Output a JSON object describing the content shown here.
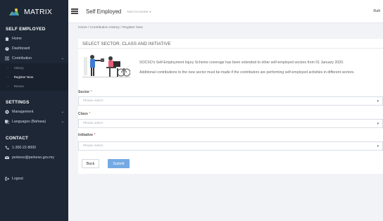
{
  "brand": {
    "name": "MATRIX"
  },
  "sidebar": {
    "section_self": "SELF EMPLOYED",
    "items": [
      {
        "label": "Home",
        "icon": "home-icon"
      },
      {
        "label": "Dashboard",
        "icon": "dashboard-icon"
      },
      {
        "label": "Contribution",
        "icon": "money-icon"
      }
    ],
    "sub_items": [
      {
        "label": "History"
      },
      {
        "label": "Register New"
      },
      {
        "label": "Renew"
      }
    ],
    "section_settings": "SETTINGS",
    "settings_items": [
      {
        "label": "Management",
        "icon": "gear-icon"
      },
      {
        "label": "Languages (Bahasa)",
        "icon": "language-icon"
      }
    ],
    "section_contact": "CONTACT",
    "contact_items": [
      {
        "label": "1-300-22-8000",
        "icon": "phone-icon"
      },
      {
        "label": "perkeso@perkeso.gov.my",
        "icon": "mail-icon"
      }
    ],
    "logout": "Logout"
  },
  "topbar": {
    "title": "Self Employed",
    "switch_mode": "SWITCH MODE ▾",
    "user": "Rafi"
  },
  "breadcrumb": "Home  /  Contribution History  /  Register New",
  "card": {
    "title": "SELECT SECTOR, CLASS AND INITIATIVE",
    "info_1": "SOCSO's Self-Employment Injury Scheme coverage has been extended to other self-employed sectors from 01 January 2020.",
    "info_2": "Additional contributions to the new sector must be made if the contributors are performing self-employed activities in different sectors."
  },
  "form": {
    "sector_label": "Sector",
    "class_label": "Class",
    "initiative_label": "Initiative",
    "required_mark": "*",
    "placeholder": "Please select",
    "arrow": "▼"
  },
  "buttons": {
    "back": "Back",
    "submit": "Submit"
  },
  "colors": {
    "sidebar": "#1d2736",
    "accent": "#74a9e4",
    "required": "#e05555"
  }
}
